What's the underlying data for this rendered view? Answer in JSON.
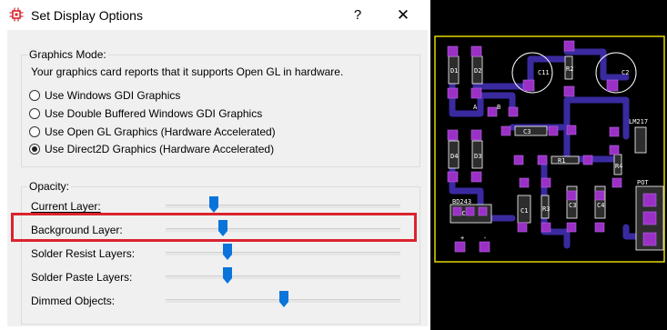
{
  "window": {
    "title": "Set Display Options",
    "help_label": "?",
    "close_label": "✕"
  },
  "graphics": {
    "group_label": "Graphics Mode:",
    "info": "Your graphics card reports that it supports Open GL in hardware.",
    "options": [
      {
        "label": "Use Windows GDI Graphics",
        "selected": false
      },
      {
        "label": "Use Double Buffered Windows GDI Graphics",
        "selected": false
      },
      {
        "label": "Use Open GL Graphics (Hardware Accelerated)",
        "selected": false
      },
      {
        "label": "Use Direct2D Graphics (Hardware Accelerated)",
        "selected": true
      }
    ]
  },
  "opacity": {
    "group_label": "Opacity:",
    "sliders": [
      {
        "label": "Current Layer:",
        "mnemonic": "C",
        "value": 0.2
      },
      {
        "label": "Background Layer:",
        "mnemonic": "B",
        "value": 0.24
      },
      {
        "label": "Solder Resist Layers:",
        "mnemonic": "S",
        "value": 0.27
      },
      {
        "label": "Solder Paste Layers:",
        "mnemonic": "S",
        "value": 0.27
      },
      {
        "label": "Dimmed Objects:",
        "mnemonic": "D",
        "value": 0.51
      }
    ]
  },
  "pcb_labels": {
    "d1": "D1",
    "d2": "D2",
    "c11": "C11",
    "r2": "R2",
    "c2": "C2",
    "a": "A",
    "b": "B",
    "c3": "C3",
    "lm217": "LM217",
    "d4": "D4",
    "d3": "D3",
    "r1": "R1",
    "r4": "R4",
    "bd243": "BD243",
    "ecb": "E C B",
    "c1": "C1",
    "r3": "R3",
    "c3b": "C3",
    "c4": "C4",
    "pot": "POT",
    "plus": "+",
    "minus": "-"
  },
  "colors": {
    "accent_red": "#d9242f",
    "slider_blue": "#0a74da",
    "pcb_pad": "#9b30c6",
    "pcb_outline": "#e6d800",
    "pcb_track": "#3a2aa0"
  }
}
